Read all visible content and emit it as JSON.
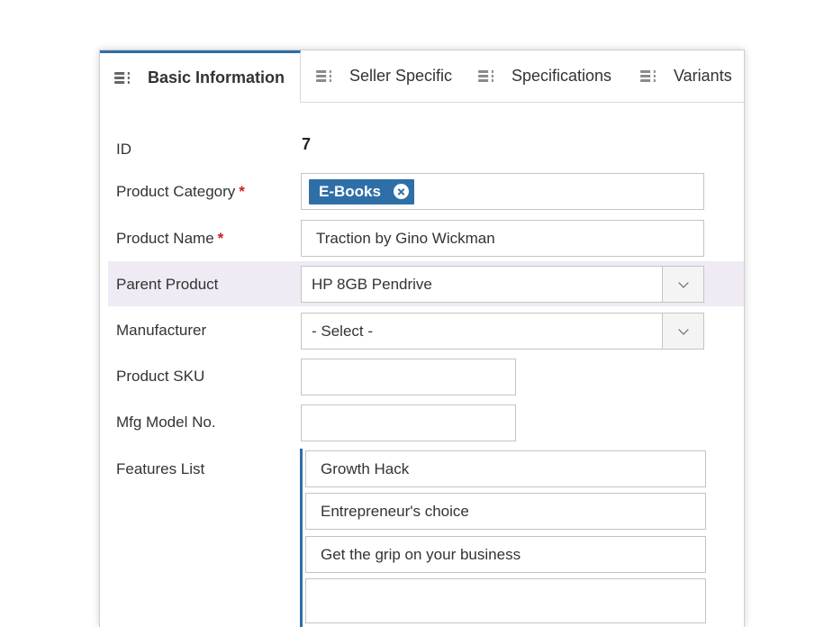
{
  "tabs": [
    {
      "label": "Basic Information",
      "active": true,
      "icon": "list-icon"
    },
    {
      "label": "Seller Specific",
      "active": false,
      "icon": "list-icon"
    },
    {
      "label": "Specifications",
      "active": false,
      "icon": "list-icon"
    },
    {
      "label": "Variants",
      "active": false,
      "icon": "list-icon"
    }
  ],
  "form": {
    "id": {
      "label": "ID",
      "value": "7"
    },
    "category": {
      "label": "Product Category",
      "required_mark": "*",
      "tag": "E-Books"
    },
    "name": {
      "label": "Product Name",
      "required_mark": "*",
      "value": "Traction by Gino Wickman"
    },
    "parent": {
      "label": "Parent Product",
      "value": "HP 8GB Pendrive"
    },
    "manufacturer": {
      "label": "Manufacturer",
      "value": "- Select -"
    },
    "sku": {
      "label": "Product SKU",
      "value": ""
    },
    "model": {
      "label": "Mfg Model No.",
      "value": ""
    },
    "features": {
      "label": "Features List",
      "items": [
        "Growth Hack",
        "Entrepreneur's choice",
        "Get the grip on your business",
        ""
      ]
    }
  },
  "colors": {
    "accent": "#2f6fa8",
    "required": "#cc1f1f",
    "highlight_row": "#efeaf4"
  }
}
